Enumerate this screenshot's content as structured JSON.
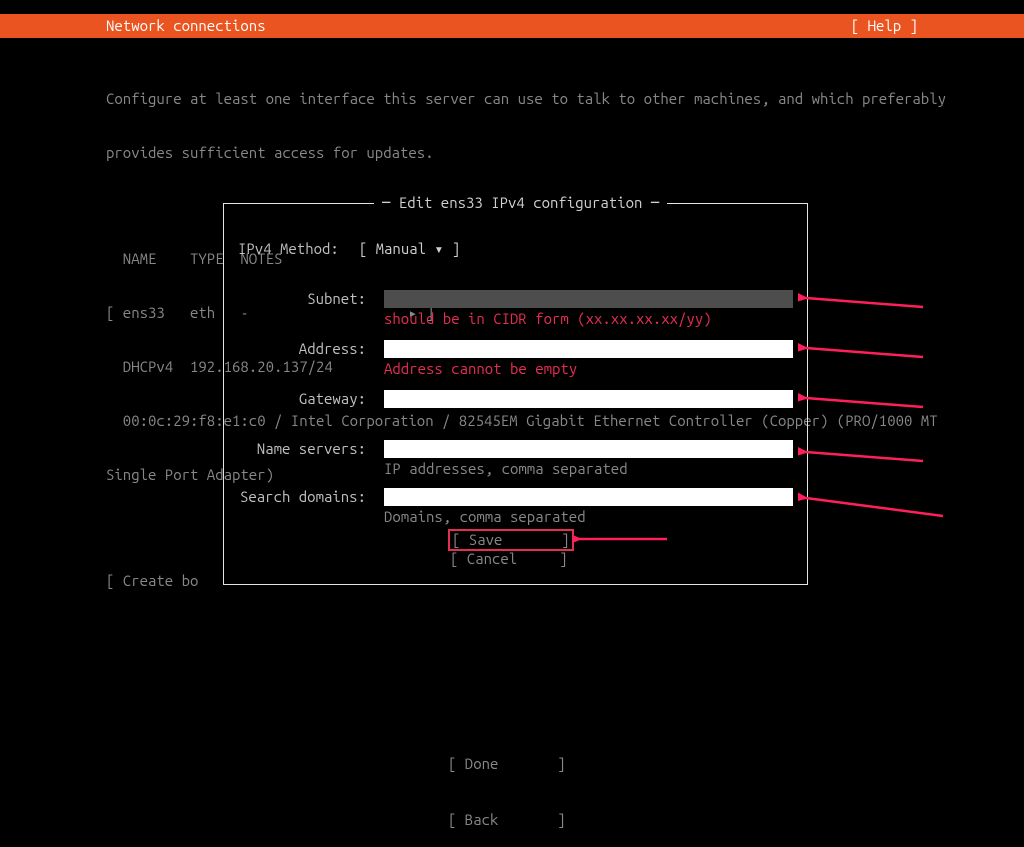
{
  "header": {
    "title": "Network connections",
    "help": "[ Help ]"
  },
  "intro": {
    "line1": "Configure at least one interface this server can use to talk to other machines, and which preferably",
    "line2": "provides sufficient access for updates."
  },
  "iface_table": {
    "headers": "  NAME    TYPE  NOTES",
    "row1": "[ ens33   eth   -                   ▸ ]",
    "row2": "  DHCPv4  192.168.20.137/24",
    "row3": "  00:0c:29:f8:e1:c0 / Intel Corporation / 82545EM Gigabit Ethernet Controller (Copper) (PRO/1000 MT",
    "row4": "Single Port Adapter)"
  },
  "create_bond": "[ Create bo",
  "dialog": {
    "title": " Edit ens33 IPv4 configuration ",
    "method_label": "IPv4 Method:",
    "method_value": "[ Manual            ▾ ]",
    "fields": {
      "subnet": {
        "label": "Subnet:",
        "value": "",
        "hint": "should be in CIDR form (xx.xx.xx.xx/yy)",
        "is_error": true
      },
      "address": {
        "label": "Address:",
        "value": "",
        "hint": "Address cannot be empty",
        "is_error": true
      },
      "gateway": {
        "label": "Gateway:",
        "value": "",
        "hint": "",
        "is_error": false
      },
      "name_servers": {
        "label": "Name servers:",
        "value": "",
        "hint": "IP addresses, comma separated",
        "is_error": false
      },
      "search_dom": {
        "label": "Search domains:",
        "value": "",
        "hint": "Domains, comma separated",
        "is_error": false
      }
    },
    "save": "[ Save       ]",
    "cancel": "[ Cancel     ]"
  },
  "footer": {
    "done": "[ Done       ]",
    "back": "[ Back       ]"
  },
  "annotations": {
    "arrow_color": "#ff1f5a"
  }
}
